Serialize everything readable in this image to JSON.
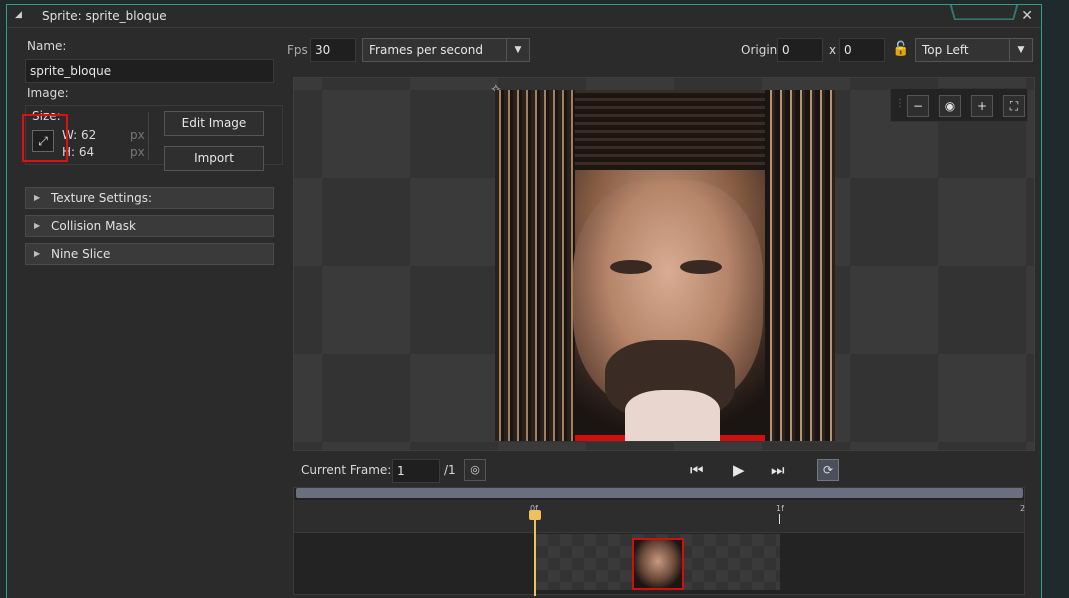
{
  "window": {
    "title": "Sprite: sprite_bloque",
    "close": "✕"
  },
  "left": {
    "name_label": "Name:",
    "name_value": "sprite_bloque",
    "image_label": "Image:",
    "size_label": "Size:",
    "width_label": "W: 62",
    "height_label": "H: 64",
    "px_w": "px",
    "px_h": "px",
    "edit_image": "Edit Image",
    "import": "Import",
    "sections": [
      "Texture Settings:",
      "Collision Mask",
      "Nine Slice"
    ]
  },
  "toolbar": {
    "fps_label": "Fps",
    "fps_value": "30",
    "speed_mode": "Frames per second",
    "origin_label": "Origin",
    "origin_x": "0",
    "x_sep": "x",
    "origin_y": "0",
    "origin_preset": "Top Left"
  },
  "playback": {
    "current_frame_label": "Current Frame:",
    "current_frame_value": "1",
    "frame_total": "/1"
  },
  "timeline": {
    "ticks": [
      "0f",
      "1f",
      "2"
    ]
  },
  "icons": {
    "zoom_out": "zoom-out-icon",
    "zoom_reset": "zoom-reset-icon",
    "zoom_in": "zoom-in-icon",
    "fullscreen": "fullscreen-icon",
    "lock": "lock-icon",
    "expand": "expand-icon"
  }
}
